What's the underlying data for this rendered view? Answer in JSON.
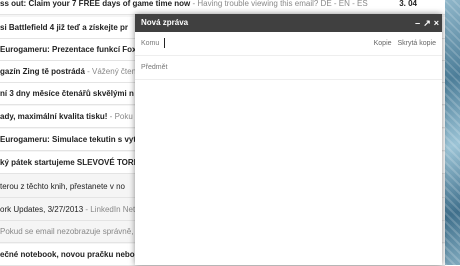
{
  "inbox": {
    "rows": [
      {
        "subject": "ss out: Claim your 7 FREE days of game time now",
        "snippet": " - Having trouble viewing this email? DE - EN - ES",
        "date": "3. 04",
        "unread": true
      },
      {
        "subject": "si Battlefield 4 již teď a získejte pr",
        "snippet": "",
        "date": "",
        "unread": true
      },
      {
        "subject": "Eurogameru: Prezentace funkcí Fox",
        "snippet": "",
        "date": "",
        "unread": true
      },
      {
        "subject": "gazín Zing tě postrádá",
        "snippet": " - Vážený čtená",
        "date": "",
        "unread": true
      },
      {
        "subject": "ní 3 dny měsíce čtenářů skvělými n",
        "snippet": "",
        "date": "",
        "unread": true
      },
      {
        "subject": "ady, maximální kvalita tisku!",
        "snippet": " - Poku",
        "date": "",
        "unread": true
      },
      {
        "subject": "Eurogameru: Simulace tekutin s vyt",
        "snippet": "",
        "date": "",
        "unread": true
      },
      {
        "subject": "ký pátek startujeme SLEVOVÉ TORN",
        "snippet": "",
        "date": "",
        "unread": true
      },
      {
        "subject": "terou z těchto knih, přestanete v no",
        "snippet": "",
        "date": "",
        "unread": false
      },
      {
        "subject": "ork Updates, 3/27/2013",
        "snippet": " - LinkedIn Netw",
        "date": "",
        "unread": false
      },
      {
        "subject": "",
        "snippet": "Pokud se email nezobrazuje správně, k",
        "date": "",
        "unread": false
      },
      {
        "subject": "ečné notebook, novou pračku nebo v",
        "snippet": "",
        "date": "",
        "unread": true
      }
    ]
  },
  "compose": {
    "title": "Nová zpráva",
    "minimize_icon": "–",
    "popout_icon": "↗",
    "close_icon": "×",
    "to_label": "Komu",
    "cc_label": "Kopie",
    "bcc_label": "Skrytá kopie",
    "subject_placeholder": "Předmět"
  }
}
